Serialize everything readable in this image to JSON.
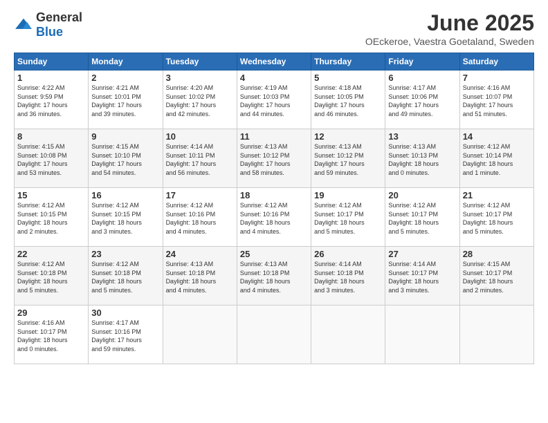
{
  "header": {
    "logo_general": "General",
    "logo_blue": "Blue",
    "month_title": "June 2025",
    "location": "OEckeroe, Vaestra Goetaland, Sweden"
  },
  "days_of_week": [
    "Sunday",
    "Monday",
    "Tuesday",
    "Wednesday",
    "Thursday",
    "Friday",
    "Saturday"
  ],
  "weeks": [
    [
      {
        "day": "1",
        "info": "Sunrise: 4:22 AM\nSunset: 9:59 PM\nDaylight: 17 hours\nand 36 minutes."
      },
      {
        "day": "2",
        "info": "Sunrise: 4:21 AM\nSunset: 10:01 PM\nDaylight: 17 hours\nand 39 minutes."
      },
      {
        "day": "3",
        "info": "Sunrise: 4:20 AM\nSunset: 10:02 PM\nDaylight: 17 hours\nand 42 minutes."
      },
      {
        "day": "4",
        "info": "Sunrise: 4:19 AM\nSunset: 10:03 PM\nDaylight: 17 hours\nand 44 minutes."
      },
      {
        "day": "5",
        "info": "Sunrise: 4:18 AM\nSunset: 10:05 PM\nDaylight: 17 hours\nand 46 minutes."
      },
      {
        "day": "6",
        "info": "Sunrise: 4:17 AM\nSunset: 10:06 PM\nDaylight: 17 hours\nand 49 minutes."
      },
      {
        "day": "7",
        "info": "Sunrise: 4:16 AM\nSunset: 10:07 PM\nDaylight: 17 hours\nand 51 minutes."
      }
    ],
    [
      {
        "day": "8",
        "info": "Sunrise: 4:15 AM\nSunset: 10:08 PM\nDaylight: 17 hours\nand 53 minutes."
      },
      {
        "day": "9",
        "info": "Sunrise: 4:15 AM\nSunset: 10:10 PM\nDaylight: 17 hours\nand 54 minutes."
      },
      {
        "day": "10",
        "info": "Sunrise: 4:14 AM\nSunset: 10:11 PM\nDaylight: 17 hours\nand 56 minutes."
      },
      {
        "day": "11",
        "info": "Sunrise: 4:13 AM\nSunset: 10:12 PM\nDaylight: 17 hours\nand 58 minutes."
      },
      {
        "day": "12",
        "info": "Sunrise: 4:13 AM\nSunset: 10:12 PM\nDaylight: 17 hours\nand 59 minutes."
      },
      {
        "day": "13",
        "info": "Sunrise: 4:13 AM\nSunset: 10:13 PM\nDaylight: 18 hours\nand 0 minutes."
      },
      {
        "day": "14",
        "info": "Sunrise: 4:12 AM\nSunset: 10:14 PM\nDaylight: 18 hours\nand 1 minute."
      }
    ],
    [
      {
        "day": "15",
        "info": "Sunrise: 4:12 AM\nSunset: 10:15 PM\nDaylight: 18 hours\nand 2 minutes."
      },
      {
        "day": "16",
        "info": "Sunrise: 4:12 AM\nSunset: 10:15 PM\nDaylight: 18 hours\nand 3 minutes."
      },
      {
        "day": "17",
        "info": "Sunrise: 4:12 AM\nSunset: 10:16 PM\nDaylight: 18 hours\nand 4 minutes."
      },
      {
        "day": "18",
        "info": "Sunrise: 4:12 AM\nSunset: 10:16 PM\nDaylight: 18 hours\nand 4 minutes."
      },
      {
        "day": "19",
        "info": "Sunrise: 4:12 AM\nSunset: 10:17 PM\nDaylight: 18 hours\nand 5 minutes."
      },
      {
        "day": "20",
        "info": "Sunrise: 4:12 AM\nSunset: 10:17 PM\nDaylight: 18 hours\nand 5 minutes."
      },
      {
        "day": "21",
        "info": "Sunrise: 4:12 AM\nSunset: 10:17 PM\nDaylight: 18 hours\nand 5 minutes."
      }
    ],
    [
      {
        "day": "22",
        "info": "Sunrise: 4:12 AM\nSunset: 10:18 PM\nDaylight: 18 hours\nand 5 minutes."
      },
      {
        "day": "23",
        "info": "Sunrise: 4:12 AM\nSunset: 10:18 PM\nDaylight: 18 hours\nand 5 minutes."
      },
      {
        "day": "24",
        "info": "Sunrise: 4:13 AM\nSunset: 10:18 PM\nDaylight: 18 hours\nand 4 minutes."
      },
      {
        "day": "25",
        "info": "Sunrise: 4:13 AM\nSunset: 10:18 PM\nDaylight: 18 hours\nand 4 minutes."
      },
      {
        "day": "26",
        "info": "Sunrise: 4:14 AM\nSunset: 10:18 PM\nDaylight: 18 hours\nand 3 minutes."
      },
      {
        "day": "27",
        "info": "Sunrise: 4:14 AM\nSunset: 10:17 PM\nDaylight: 18 hours\nand 3 minutes."
      },
      {
        "day": "28",
        "info": "Sunrise: 4:15 AM\nSunset: 10:17 PM\nDaylight: 18 hours\nand 2 minutes."
      }
    ],
    [
      {
        "day": "29",
        "info": "Sunrise: 4:16 AM\nSunset: 10:17 PM\nDaylight: 18 hours\nand 0 minutes."
      },
      {
        "day": "30",
        "info": "Sunrise: 4:17 AM\nSunset: 10:16 PM\nDaylight: 17 hours\nand 59 minutes."
      },
      {
        "day": "",
        "info": ""
      },
      {
        "day": "",
        "info": ""
      },
      {
        "day": "",
        "info": ""
      },
      {
        "day": "",
        "info": ""
      },
      {
        "day": "",
        "info": ""
      }
    ]
  ]
}
